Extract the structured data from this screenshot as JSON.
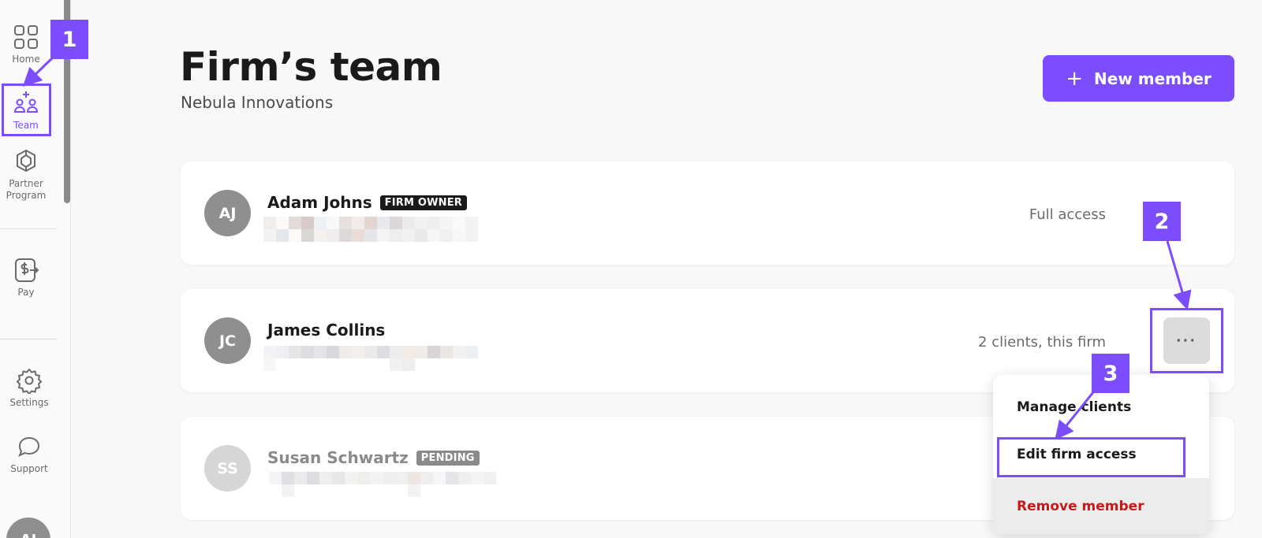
{
  "sidebar": {
    "items": [
      {
        "label": "Home",
        "icon": "grid-icon"
      },
      {
        "label": "Team",
        "icon": "team-icon",
        "active": true
      },
      {
        "label": "Partner Program",
        "icon": "gem-icon"
      },
      {
        "label": "Pay",
        "icon": "dollar-transfer-icon"
      },
      {
        "label": "Settings",
        "icon": "gear-icon"
      },
      {
        "label": "Support",
        "icon": "chat-bubble-icon"
      }
    ],
    "user_avatar": "AJ"
  },
  "header": {
    "title": "Firm’s team",
    "subtitle": "Nebula Innovations",
    "new_member_label": "New member"
  },
  "members": [
    {
      "initials": "AJ",
      "name": "Adam Johns",
      "badge": "FIRM OWNER",
      "access": "Full access",
      "status": "active"
    },
    {
      "initials": "JC",
      "name": "James Collins",
      "badge": "",
      "access": "2 clients, this firm",
      "status": "active"
    },
    {
      "initials": "SS",
      "name": "Susan Schwartz",
      "badge": "PENDING",
      "access": "",
      "status": "pending"
    }
  ],
  "menu": {
    "items": [
      "Manage clients",
      "Edit firm access",
      "Remove member"
    ]
  },
  "annotations": {
    "steps": [
      "1",
      "2",
      "3"
    ]
  },
  "colors": {
    "accent": "#7b4dff",
    "danger": "#c81a1a",
    "avatar_active": "#8f8f8f",
    "avatar_pending": "#d6d6d6",
    "badge_owner": "#1a1a1a",
    "badge_pending": "#8a8a8a"
  }
}
